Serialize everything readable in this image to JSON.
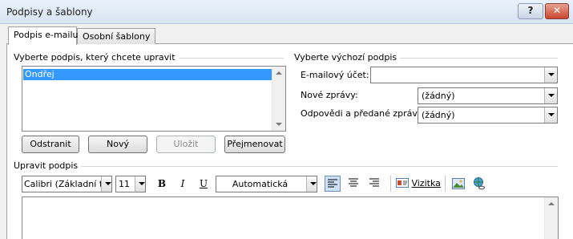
{
  "window": {
    "title": "Podpisy a šablony",
    "help_label": "?",
    "close_label": "✕"
  },
  "tabs": [
    {
      "label": "Podpis e-mailu",
      "active": true
    },
    {
      "label": "Osobní šablony",
      "active": false
    }
  ],
  "select_signature": {
    "group_label": "Vyberte podpis, který chcete upravit",
    "items": [
      "Ondřej"
    ],
    "selected": "Ondřej",
    "buttons": {
      "delete": "Odstranit",
      "new": "Nový",
      "save": "Uložit",
      "rename": "Přejmenovat"
    }
  },
  "default_signature": {
    "group_label": "Vyberte výchozí podpis",
    "account_label": "E-mailový účet:",
    "account_value": "",
    "new_messages_label": "Nové zprávy:",
    "new_messages_value": "(žádný)",
    "replies_label": "Odpovědi a předané zprávy:",
    "replies_value": "(žádný)"
  },
  "edit_signature": {
    "group_label": "Upravit podpis",
    "font": "Calibri (Základní tex",
    "size": "11",
    "bold": "B",
    "italic": "I",
    "underline": "U",
    "color": "Automatická",
    "business_card": "Vizitka",
    "alignment": "left"
  }
}
